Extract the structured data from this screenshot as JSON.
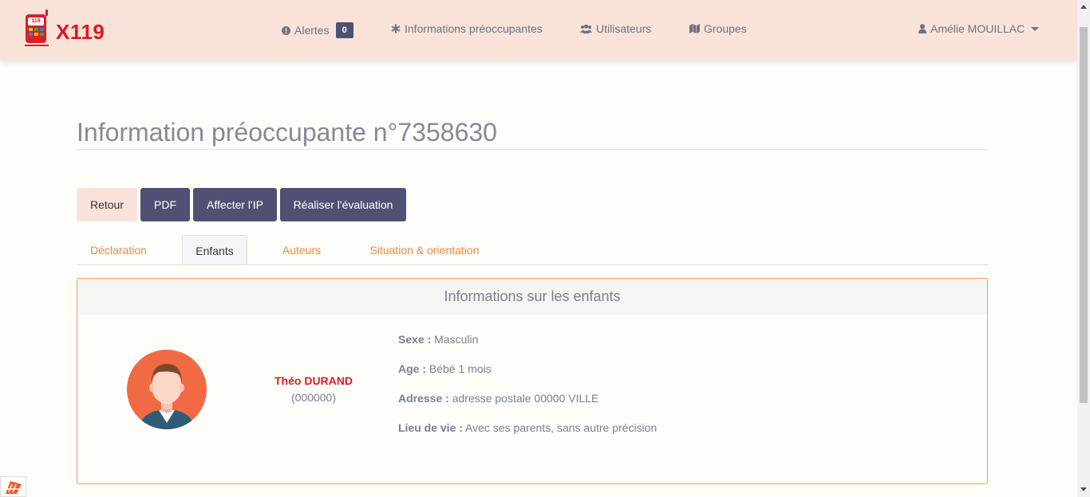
{
  "brand": {
    "name": "X119",
    "logo_number": "119"
  },
  "nav": {
    "alerts_label": "Alertes",
    "alerts_count": "0",
    "ip_label": "Informations préoccupantes",
    "users_label": "Utilisateurs",
    "groups_label": "Groupes",
    "user_name": "Amélie MOUILLAC"
  },
  "page": {
    "title": "Information préoccupante n°7358630"
  },
  "actions": {
    "back": "Retour",
    "pdf": "PDF",
    "assign": "Affecter l'IP",
    "evaluate": "Réaliser l'évaluation"
  },
  "tabs": [
    {
      "label": "Déclaration",
      "active": false
    },
    {
      "label": "Enfants",
      "active": true
    },
    {
      "label": "Auteurs",
      "active": false
    },
    {
      "label": "Situation & orientation",
      "active": false
    }
  ],
  "panel": {
    "title": "Informations sur les enfants",
    "child": {
      "name": "Théo DURAND",
      "id": "(000000)",
      "sex_label": "Sexe :",
      "sex": "Masculin",
      "age_label": "Age :",
      "age": "Bébé 1 mois",
      "address_label": "Adresse :",
      "address": "adresse postale 00000 VILLE",
      "living_label": "Lieu de vie :",
      "living": "Avec ses parents, sans autre précision"
    }
  },
  "colors": {
    "navbar_bg": "#f9e3d8",
    "brand_red": "#e0161f",
    "button_dark": "#4f5074",
    "tab_orange": "#ef8a45",
    "panel_border": "#ef9a68",
    "child_name": "#d81f26"
  },
  "icons": {
    "alerts": "exclamation-circle-icon",
    "ip": "asterisk-icon",
    "users": "users-icon",
    "groups": "map-icon",
    "user": "user-icon",
    "avatar": "child-avatar-icon"
  }
}
